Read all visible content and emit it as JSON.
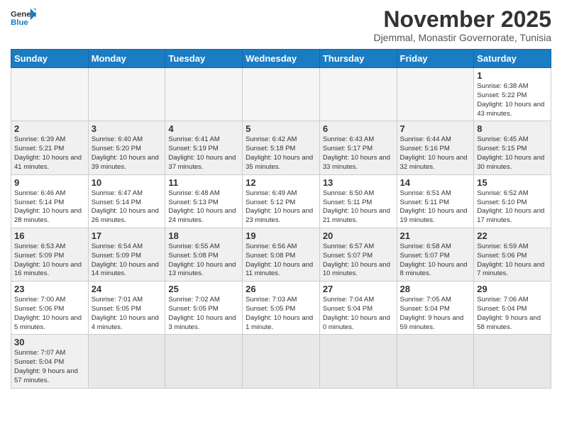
{
  "header": {
    "logo_general": "General",
    "logo_blue": "Blue",
    "month_title": "November 2025",
    "subtitle": "Djemmal, Monastir Governorate, Tunisia"
  },
  "weekdays": [
    "Sunday",
    "Monday",
    "Tuesday",
    "Wednesday",
    "Thursday",
    "Friday",
    "Saturday"
  ],
  "weeks": [
    [
      {
        "day": "",
        "info": ""
      },
      {
        "day": "",
        "info": ""
      },
      {
        "day": "",
        "info": ""
      },
      {
        "day": "",
        "info": ""
      },
      {
        "day": "",
        "info": ""
      },
      {
        "day": "",
        "info": ""
      },
      {
        "day": "1",
        "info": "Sunrise: 6:38 AM\nSunset: 5:22 PM\nDaylight: 10 hours and 43 minutes."
      }
    ],
    [
      {
        "day": "2",
        "info": "Sunrise: 6:39 AM\nSunset: 5:21 PM\nDaylight: 10 hours and 41 minutes."
      },
      {
        "day": "3",
        "info": "Sunrise: 6:40 AM\nSunset: 5:20 PM\nDaylight: 10 hours and 39 minutes."
      },
      {
        "day": "4",
        "info": "Sunrise: 6:41 AM\nSunset: 5:19 PM\nDaylight: 10 hours and 37 minutes."
      },
      {
        "day": "5",
        "info": "Sunrise: 6:42 AM\nSunset: 5:18 PM\nDaylight: 10 hours and 35 minutes."
      },
      {
        "day": "6",
        "info": "Sunrise: 6:43 AM\nSunset: 5:17 PM\nDaylight: 10 hours and 33 minutes."
      },
      {
        "day": "7",
        "info": "Sunrise: 6:44 AM\nSunset: 5:16 PM\nDaylight: 10 hours and 32 minutes."
      },
      {
        "day": "8",
        "info": "Sunrise: 6:45 AM\nSunset: 5:15 PM\nDaylight: 10 hours and 30 minutes."
      }
    ],
    [
      {
        "day": "9",
        "info": "Sunrise: 6:46 AM\nSunset: 5:14 PM\nDaylight: 10 hours and 28 minutes."
      },
      {
        "day": "10",
        "info": "Sunrise: 6:47 AM\nSunset: 5:14 PM\nDaylight: 10 hours and 26 minutes."
      },
      {
        "day": "11",
        "info": "Sunrise: 6:48 AM\nSunset: 5:13 PM\nDaylight: 10 hours and 24 minutes."
      },
      {
        "day": "12",
        "info": "Sunrise: 6:49 AM\nSunset: 5:12 PM\nDaylight: 10 hours and 23 minutes."
      },
      {
        "day": "13",
        "info": "Sunrise: 6:50 AM\nSunset: 5:11 PM\nDaylight: 10 hours and 21 minutes."
      },
      {
        "day": "14",
        "info": "Sunrise: 6:51 AM\nSunset: 5:11 PM\nDaylight: 10 hours and 19 minutes."
      },
      {
        "day": "15",
        "info": "Sunrise: 6:52 AM\nSunset: 5:10 PM\nDaylight: 10 hours and 17 minutes."
      }
    ],
    [
      {
        "day": "16",
        "info": "Sunrise: 6:53 AM\nSunset: 5:09 PM\nDaylight: 10 hours and 16 minutes."
      },
      {
        "day": "17",
        "info": "Sunrise: 6:54 AM\nSunset: 5:09 PM\nDaylight: 10 hours and 14 minutes."
      },
      {
        "day": "18",
        "info": "Sunrise: 6:55 AM\nSunset: 5:08 PM\nDaylight: 10 hours and 13 minutes."
      },
      {
        "day": "19",
        "info": "Sunrise: 6:56 AM\nSunset: 5:08 PM\nDaylight: 10 hours and 11 minutes."
      },
      {
        "day": "20",
        "info": "Sunrise: 6:57 AM\nSunset: 5:07 PM\nDaylight: 10 hours and 10 minutes."
      },
      {
        "day": "21",
        "info": "Sunrise: 6:58 AM\nSunset: 5:07 PM\nDaylight: 10 hours and 8 minutes."
      },
      {
        "day": "22",
        "info": "Sunrise: 6:59 AM\nSunset: 5:06 PM\nDaylight: 10 hours and 7 minutes."
      }
    ],
    [
      {
        "day": "23",
        "info": "Sunrise: 7:00 AM\nSunset: 5:06 PM\nDaylight: 10 hours and 5 minutes."
      },
      {
        "day": "24",
        "info": "Sunrise: 7:01 AM\nSunset: 5:05 PM\nDaylight: 10 hours and 4 minutes."
      },
      {
        "day": "25",
        "info": "Sunrise: 7:02 AM\nSunset: 5:05 PM\nDaylight: 10 hours and 3 minutes."
      },
      {
        "day": "26",
        "info": "Sunrise: 7:03 AM\nSunset: 5:05 PM\nDaylight: 10 hours and 1 minute."
      },
      {
        "day": "27",
        "info": "Sunrise: 7:04 AM\nSunset: 5:04 PM\nDaylight: 10 hours and 0 minutes."
      },
      {
        "day": "28",
        "info": "Sunrise: 7:05 AM\nSunset: 5:04 PM\nDaylight: 9 hours and 59 minutes."
      },
      {
        "day": "29",
        "info": "Sunrise: 7:06 AM\nSunset: 5:04 PM\nDaylight: 9 hours and 58 minutes."
      }
    ],
    [
      {
        "day": "30",
        "info": "Sunrise: 7:07 AM\nSunset: 5:04 PM\nDaylight: 9 hours and 57 minutes."
      },
      {
        "day": "",
        "info": ""
      },
      {
        "day": "",
        "info": ""
      },
      {
        "day": "",
        "info": ""
      },
      {
        "day": "",
        "info": ""
      },
      {
        "day": "",
        "info": ""
      },
      {
        "day": "",
        "info": ""
      }
    ]
  ]
}
